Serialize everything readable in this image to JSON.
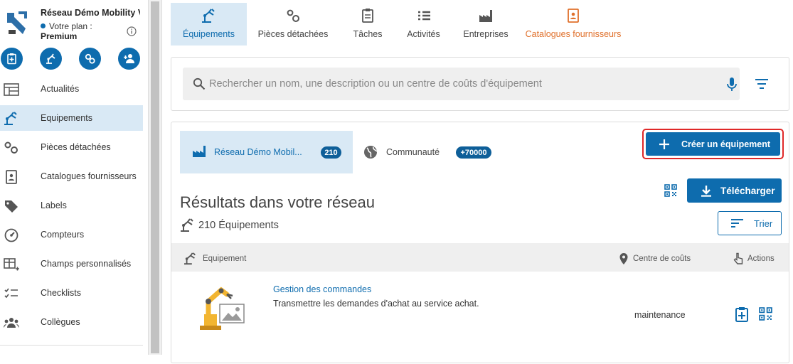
{
  "sidebar": {
    "org_name": "Réseau Démo Mobility V",
    "plan_label": "Votre plan :",
    "plan_value": "Premium",
    "items": [
      {
        "label": "Actualités",
        "icon": "news-icon"
      },
      {
        "label": "Equipements",
        "icon": "equipment-icon",
        "active": true
      },
      {
        "label": "Pièces détachées",
        "icon": "gears-icon"
      },
      {
        "label": "Catalogues fournisseurs",
        "icon": "supplier-catalog-icon"
      },
      {
        "label": "Labels",
        "icon": "label-tag-icon"
      },
      {
        "label": "Compteurs",
        "icon": "meter-icon"
      },
      {
        "label": "Champs personnalisés",
        "icon": "custom-fields-icon"
      },
      {
        "label": "Checklists",
        "icon": "checklist-icon"
      },
      {
        "label": "Collègues",
        "icon": "colleagues-icon"
      }
    ]
  },
  "tabs": [
    {
      "label": "Équipements",
      "icon": "equipment-icon",
      "active": true
    },
    {
      "label": "Pièces détachées",
      "icon": "gears-icon"
    },
    {
      "label": "Tâches",
      "icon": "clipboard-icon"
    },
    {
      "label": "Activités",
      "icon": "list-icon"
    },
    {
      "label": "Entreprises",
      "icon": "factory-icon"
    },
    {
      "label": "Catalogues fournisseurs",
      "icon": "supplier-catalog-icon"
    }
  ],
  "search": {
    "placeholder": "Rechercher un nom, une description ou un centre de coûts d'équipement"
  },
  "results": {
    "network_tab_label": "Réseau Démo Mobil...",
    "network_count": "210",
    "community_tab_label": "Communauté",
    "community_count": "+70000",
    "create_label": "Créer un équipement",
    "download_label": "Télécharger",
    "sort_label": "Trier",
    "title": "Résultats dans votre réseau",
    "count_label": "210 Équipements",
    "columns": {
      "equipment": "Equipement",
      "cost_center": "Centre de coûts",
      "actions": "Actions"
    },
    "rows": [
      {
        "name": "Gestion des commandes",
        "description": "Transmettre les demandes d'achat au service achat.",
        "cost_center": "maintenance"
      }
    ]
  },
  "colors": {
    "primary": "#0e6cae",
    "active_bg": "#d9e9f5",
    "supplier_tab": "#e0702b",
    "highlight_border": "#e02828"
  }
}
